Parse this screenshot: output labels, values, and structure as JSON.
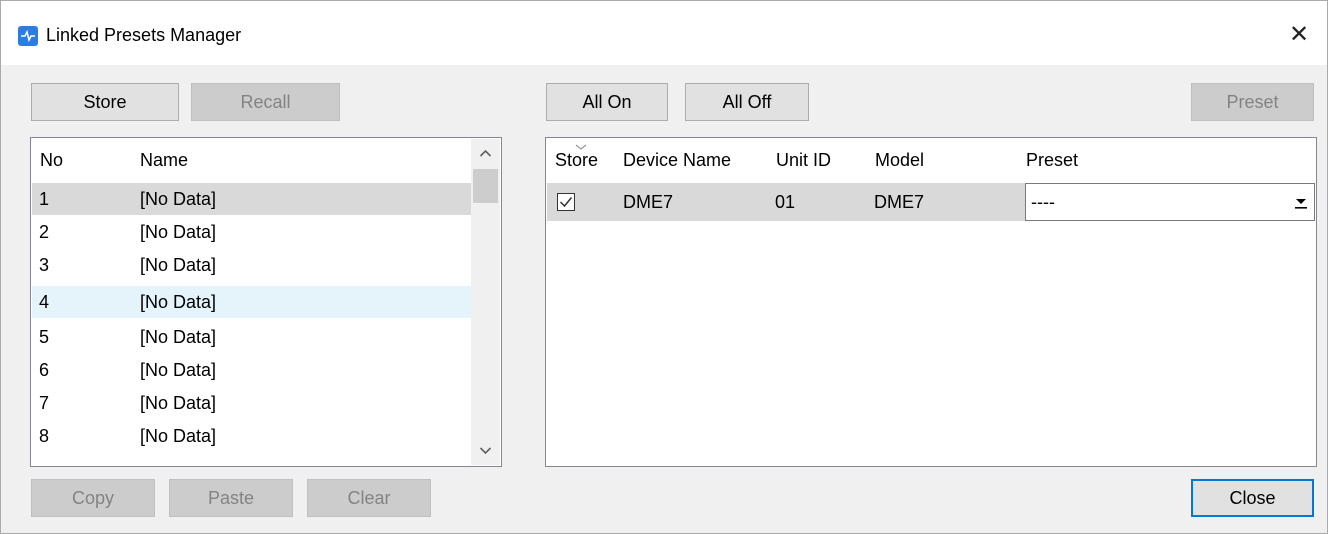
{
  "window": {
    "title": "Linked Presets Manager",
    "close_glyph": "✕"
  },
  "left": {
    "store_label": "Store",
    "recall_label": "Recall",
    "columns": {
      "no": "No",
      "name": "Name"
    },
    "rows": [
      {
        "no": "1",
        "name": "[No Data]"
      },
      {
        "no": "2",
        "name": "[No Data]"
      },
      {
        "no": "3",
        "name": "[No Data]"
      },
      {
        "no": "4",
        "name": "[No Data]"
      },
      {
        "no": "5",
        "name": "[No Data]"
      },
      {
        "no": "6",
        "name": "[No Data]"
      },
      {
        "no": "7",
        "name": "[No Data]"
      },
      {
        "no": "8",
        "name": "[No Data]"
      }
    ],
    "copy_label": "Copy",
    "paste_label": "Paste",
    "clear_label": "Clear"
  },
  "right": {
    "all_on_label": "All On",
    "all_off_label": "All Off",
    "preset_label": "Preset",
    "columns": {
      "store": "Store",
      "device_name": "Device Name",
      "unit_id": "Unit ID",
      "model": "Model",
      "preset": "Preset"
    },
    "device": {
      "store_checked": true,
      "device_name": "DME7",
      "unit_id": "01",
      "model": "DME7",
      "preset": "----"
    }
  },
  "close_label": "Close",
  "icons": [
    "app-icon",
    "close-icon",
    "scroll-up-icon",
    "scroll-down-icon",
    "sort-indicator-icon",
    "checkbox-checked-icon",
    "dropdown-arrow-icon"
  ],
  "colors": {
    "accent": "#0078d7",
    "selection_gray": "#d9d9d9",
    "hover_blue": "#e5f3fb",
    "disabled_text": "#838383"
  }
}
